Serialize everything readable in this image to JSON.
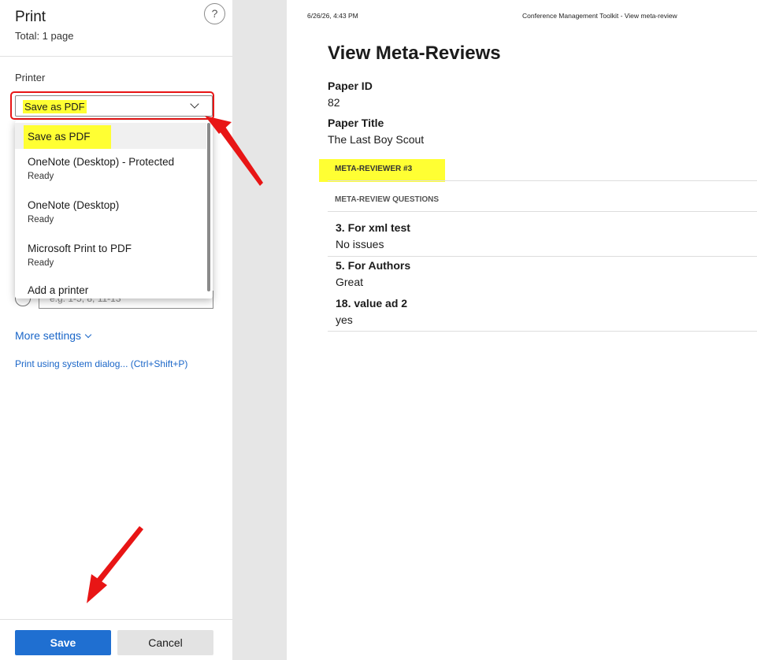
{
  "panel": {
    "title": "Print",
    "total": "Total: 1 page",
    "help_label": "?",
    "printer_label": "Printer",
    "printer_selected": "Save as PDF",
    "pages_placeholder": "e.g. 1-5, 8, 11-13",
    "more_settings": "More settings",
    "system_dialog": "Print using system dialog... (Ctrl+Shift+P)",
    "save_label": "Save",
    "cancel_label": "Cancel"
  },
  "dropdown": {
    "items": [
      {
        "name": "Save as PDF",
        "status": ""
      },
      {
        "name": "OneNote (Desktop) - Protected",
        "status": "Ready"
      },
      {
        "name": "OneNote (Desktop)",
        "status": "Ready"
      },
      {
        "name": "Microsoft Print to PDF",
        "status": "Ready"
      },
      {
        "name": "Add a printer",
        "status": ""
      }
    ]
  },
  "preview": {
    "header_date": "6/26/26, 4:43 PM",
    "header_title": "Conference Management Toolkit - View meta-review",
    "heading": "View Meta-Reviews",
    "paper_id_label": "Paper ID",
    "paper_id": "82",
    "paper_title_label": "Paper Title",
    "paper_title": "The Last Boy Scout",
    "meta_reviewer": "META-REVIEWER #3",
    "questions_label": "META-REVIEW QUESTIONS",
    "questions": [
      {
        "title": "3. For xml test",
        "answer": "No issues"
      },
      {
        "title": "5. For Authors",
        "answer": "Great"
      },
      {
        "title": "18. value ad 2",
        "answer": "yes"
      }
    ]
  },
  "colors": {
    "accent": "#1f6fd1",
    "link": "#1a66c8",
    "highlight": "#ffff33",
    "annotation": "#e81515"
  }
}
